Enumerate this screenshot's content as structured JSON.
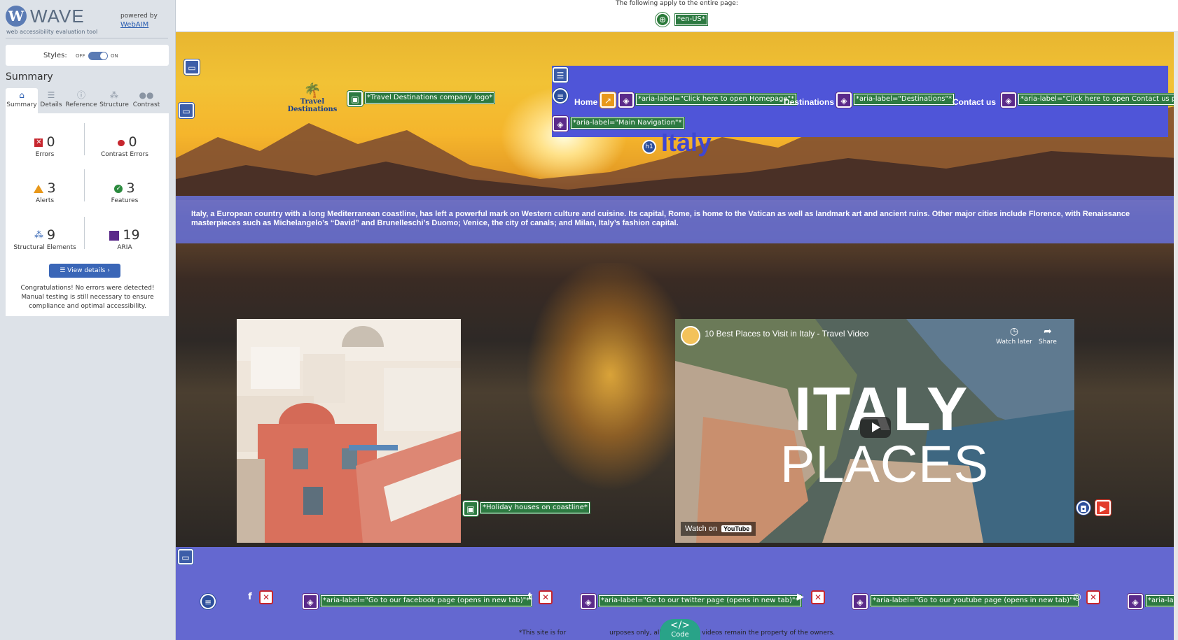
{
  "wave": {
    "title": "WAVE",
    "subtitle": "web accessibility evaluation tool",
    "powered_by": "powered by",
    "webaim_link": "WebAIM",
    "styles_label": "Styles:",
    "styles_off": "OFF",
    "styles_on": "ON",
    "summary_heading": "Summary",
    "tabs": [
      {
        "label": "Summary",
        "icon": "home-icon",
        "active": true
      },
      {
        "label": "Details",
        "icon": "list-icon",
        "active": false
      },
      {
        "label": "Reference",
        "icon": "info-icon",
        "active": false
      },
      {
        "label": "Structure",
        "icon": "structure-icon",
        "active": false
      },
      {
        "label": "Contrast",
        "icon": "contrast-icon",
        "active": false
      }
    ],
    "stats": {
      "errors": {
        "value": "0",
        "label": "Errors"
      },
      "contrast_errors": {
        "value": "0",
        "label": "Contrast Errors"
      },
      "alerts": {
        "value": "3",
        "label": "Alerts"
      },
      "features": {
        "value": "3",
        "label": "Features"
      },
      "structural": {
        "value": "9",
        "label": "Structural Elements"
      },
      "aria": {
        "value": "19",
        "label": "ARIA"
      }
    },
    "view_details": "View details ›",
    "congrats": "Congratulations! No errors were detected! Manual testing is still necessary to ensure compliance and optimal accessibility."
  },
  "page": {
    "applies_text": "The following apply to the entire page:",
    "lang_label": "*en-US*",
    "logo_text": "Travel Destinations",
    "logo_alt_label": "*Travel Destinations company logo*",
    "nav": {
      "home": "Home",
      "home_aria": "*aria-label=\"Click here to open Homepage\"*",
      "destinations": "Destinations",
      "destinations_aria": "*aria-label=\"Destinations\"*",
      "contact": "Contact us",
      "contact_aria": "*aria-label=\"Click here to open Contact us page\"*",
      "main_nav_aria": "*aria-label=\"Main Navigation\"*"
    },
    "h1_icon": "h1",
    "heading": "Italy",
    "intro": "Italy, a European country with a long Mediterranean coastline, has left a powerful mark on Western culture and cuisine. Its capital, Rome, is home to the Vatican as well as landmark art and ancient ruins. Other major cities include Florence, with Renaissance masterpieces such as Michelangelo’s “David” and Brunelleschi’s Duomo; Venice, the city of canals; and Milan, Italy’s fashion capital.",
    "photo_alt_label": "*Holiday houses on coastline*",
    "video": {
      "title": "10 Best Places to Visit in Italy - Travel Video",
      "watch_later": "Watch later",
      "share": "Share",
      "big_text_1": "ITALY",
      "big_text_2": "PLACES",
      "watch_on": "Watch on",
      "youtube": "YouTube"
    },
    "footer": {
      "facebook_aria": "*aria-label=\"Go to our facebook page (opens in new tab)\"*",
      "twitter_aria": "*aria-label=\"Go to our twitter page (opens in new tab)\"*",
      "youtube_aria": "*aria-label=\"Go to our youtube page (opens in new tab)\"*",
      "instagram_aria": "*aria-labe",
      "note_left": "*This site is for",
      "note_right": "urposes only, all images and videos remain the property of the owners."
    },
    "code_button": {
      "icon": "</>",
      "label": "Code"
    }
  },
  "colors": {
    "wave_accent": "#3a66b7",
    "nav_bg": "#4f55d8",
    "heading": "#3f47d1",
    "footer_bg": "#6468d0",
    "label_green": "#2d7a41",
    "aria_purple": "#5b2a8a"
  }
}
